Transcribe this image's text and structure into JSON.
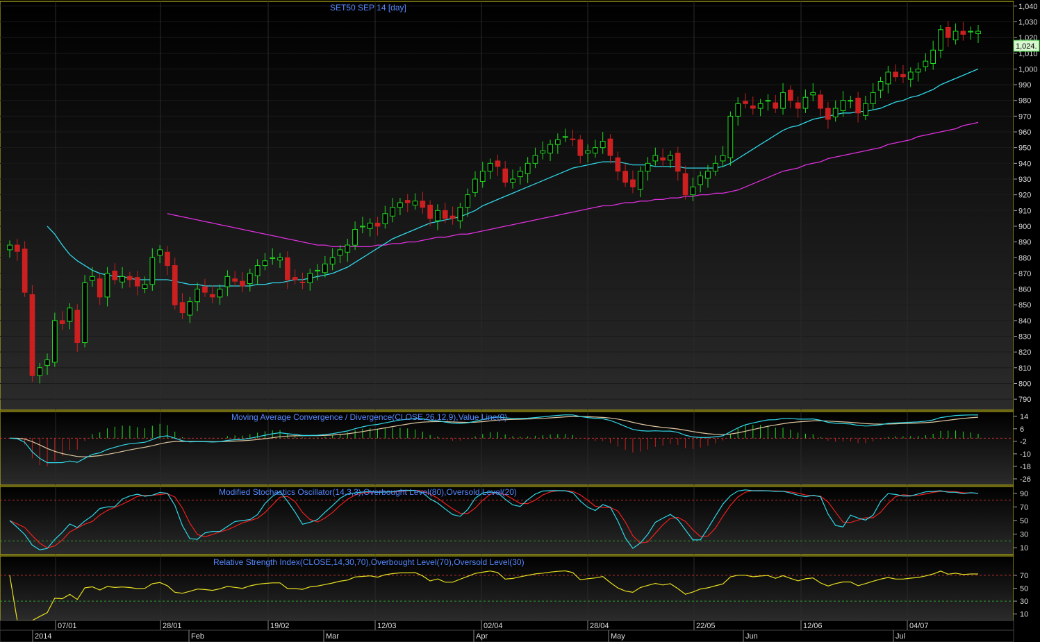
{
  "title": "SET50 SEP 14   [day]",
  "last_price_label": "1,024.",
  "colors": {
    "up": "#22dd22",
    "down": "#cc2020",
    "sma20": "#30d8e8",
    "sma60": "#e030e0",
    "macd": "#30d8e8",
    "signal": "#e0c8a0",
    "stoch_k": "#30d8e8",
    "stoch_d": "#ee2020",
    "rsi": "#e8e020",
    "panel_border": "#d8d020",
    "label": "#5588ff"
  },
  "panels": {
    "macd_title": "Moving Average Convergence / Divergence(CLOSE,26,12,9),Value Line(0)",
    "stoch_title": "Modified Stochastics Oscillator(14,3,3),Overbought Level(80),Oversold Level(20)",
    "rsi_title": "Relative Strength Index(CLOSE,14,30,70),Overbought Level(70),Oversold Level(30)"
  },
  "chart_data": {
    "type": "candlestick",
    "period": "day",
    "price_ylim": [
      783,
      1043
    ],
    "price_ticks": [
      790,
      800,
      810,
      820,
      830,
      840,
      850,
      860,
      870,
      880,
      890,
      900,
      910,
      920,
      930,
      940,
      950,
      960,
      970,
      980,
      990,
      1000,
      1010,
      1020,
      1030,
      1040
    ],
    "macd_ticks": [
      14,
      6,
      -2,
      -10,
      -18,
      -26
    ],
    "macd_ylim": [
      -30,
      17
    ],
    "stoch_ticks": [
      90,
      70,
      50,
      30,
      10
    ],
    "rsi_ticks": [
      70,
      50,
      30,
      10
    ],
    "oscillator_ylim": [
      0,
      100
    ],
    "date_labels": [
      "07/01",
      "28/01",
      "19/02",
      "12/03",
      "02/04",
      "28/04",
      "22/05",
      "12/06",
      "04/07"
    ],
    "month_labels": [
      "2014",
      "Feb",
      "Mar",
      "Apr",
      "May",
      "Jun",
      "Jul"
    ],
    "closes": [
      888,
      884,
      858,
      805,
      810,
      815,
      840,
      838,
      848,
      826,
      864,
      868,
      855,
      870,
      866,
      868,
      866,
      862,
      863,
      880,
      885,
      875,
      850,
      845,
      852,
      860,
      858,
      855,
      860,
      868,
      865,
      862,
      870,
      875,
      878,
      880,
      880,
      866,
      866,
      864,
      870,
      872,
      876,
      880,
      885,
      888,
      898,
      900,
      902,
      900,
      908,
      912,
      915,
      915,
      916,
      912,
      905,
      910,
      905,
      905,
      912,
      920,
      930,
      935,
      940,
      938,
      928,
      930,
      935,
      940,
      945,
      948,
      952,
      955,
      957,
      955,
      945,
      948,
      950,
      954,
      945,
      935,
      928,
      925,
      935,
      940,
      945,
      942,
      945,
      935,
      920,
      925,
      932,
      935,
      940,
      945,
      970,
      978,
      978,
      975,
      978,
      980,
      975,
      985,
      980,
      975,
      982,
      985,
      975,
      968,
      975,
      980,
      980,
      972,
      978,
      985,
      992,
      998,
      995,
      995,
      998,
      1000,
      1005,
      1012,
      1025,
      1020,
      1024,
      1022,
      1024,
      1024
    ],
    "sma20": [
      null,
      null,
      null,
      null,
      null,
      900,
      895,
      888,
      882,
      878,
      875,
      872,
      870,
      869,
      868,
      868,
      867,
      866,
      866,
      866,
      866,
      866,
      865,
      864,
      863,
      863,
      862,
      862,
      862,
      862,
      862,
      862,
      862,
      863,
      863,
      864,
      864,
      865,
      866,
      866,
      867,
      868,
      869,
      870,
      872,
      874,
      877,
      880,
      883,
      886,
      889,
      892,
      894,
      896,
      898,
      900,
      902,
      903,
      904,
      905,
      906,
      908,
      910,
      913,
      915,
      917,
      919,
      921,
      923,
      925,
      927,
      929,
      931,
      933,
      935,
      937,
      938,
      939,
      940,
      941,
      941,
      941,
      940,
      939,
      939,
      939,
      938,
      938,
      938,
      938,
      937,
      937,
      937,
      937,
      937,
      938,
      940,
      943,
      946,
      949,
      952,
      955,
      958,
      961,
      963,
      964,
      966,
      968,
      969,
      970,
      971,
      972,
      972,
      973,
      973,
      974,
      975,
      977,
      979,
      980,
      982,
      983,
      985,
      987,
      990,
      992,
      994,
      996,
      998,
      1000
    ],
    "sma60": [
      null,
      null,
      null,
      null,
      null,
      null,
      null,
      null,
      null,
      null,
      null,
      null,
      null,
      null,
      null,
      null,
      null,
      null,
      null,
      null,
      null,
      908,
      907,
      906,
      905,
      904,
      903,
      902,
      901,
      900,
      899,
      898,
      897,
      896,
      895,
      894,
      893,
      892,
      891,
      890,
      889,
      888,
      888,
      887,
      887,
      887,
      887,
      887,
      887,
      888,
      888,
      889,
      889,
      890,
      890,
      891,
      892,
      893,
      893,
      894,
      895,
      895,
      896,
      897,
      898,
      899,
      900,
      901,
      902,
      903,
      904,
      905,
      906,
      907,
      908,
      909,
      910,
      911,
      912,
      913,
      913,
      914,
      915,
      915,
      916,
      916,
      917,
      917,
      918,
      918,
      919,
      919,
      920,
      920,
      921,
      921,
      922,
      923,
      925,
      927,
      929,
      931,
      933,
      935,
      936,
      937,
      939,
      940,
      941,
      943,
      944,
      945,
      946,
      947,
      948,
      949,
      950,
      952,
      953,
      954,
      955,
      957,
      958,
      959,
      960,
      961,
      962,
      964,
      965,
      966
    ]
  }
}
